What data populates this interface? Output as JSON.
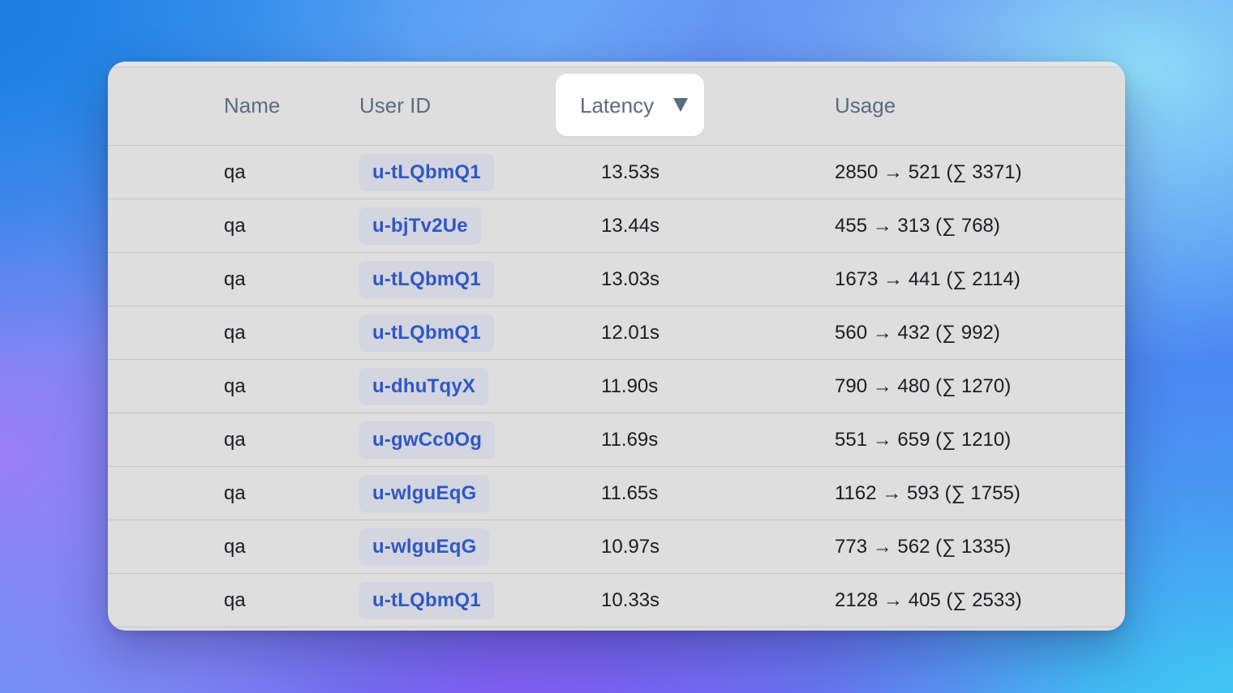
{
  "columns": {
    "name": "Name",
    "user_id": "User ID",
    "latency": "Latency",
    "usage": "Usage"
  },
  "sort": {
    "column": "Latency",
    "direction": "descending"
  },
  "colors": {
    "link": "#2f58c3",
    "chip_bg": "#d3d5e0",
    "header_text": "#5c6b82"
  },
  "rows": [
    {
      "name": "qa",
      "user_id": "u-tLQbmQ1",
      "latency": "13.53s",
      "usage": "2850 → 521 (∑ 3371)"
    },
    {
      "name": "qa",
      "user_id": "u-bjTv2Ue",
      "latency": "13.44s",
      "usage": "455 → 313 (∑ 768)"
    },
    {
      "name": "qa",
      "user_id": "u-tLQbmQ1",
      "latency": "13.03s",
      "usage": "1673 → 441 (∑ 2114)"
    },
    {
      "name": "qa",
      "user_id": "u-tLQbmQ1",
      "latency": "12.01s",
      "usage": "560 → 432 (∑ 992)"
    },
    {
      "name": "qa",
      "user_id": "u-dhuTqyX",
      "latency": "11.90s",
      "usage": "790 → 480 (∑ 1270)"
    },
    {
      "name": "qa",
      "user_id": "u-gwCc0Og",
      "latency": "11.69s",
      "usage": "551 → 659 (∑ 1210)"
    },
    {
      "name": "qa",
      "user_id": "u-wlguEqG",
      "latency": "11.65s",
      "usage": "1162 → 593 (∑ 1755)"
    },
    {
      "name": "qa",
      "user_id": "u-wlguEqG",
      "latency": "10.97s",
      "usage": "773 → 562 (∑ 1335)"
    },
    {
      "name": "qa",
      "user_id": "u-tLQbmQ1",
      "latency": "10.33s",
      "usage": "2128 → 405 (∑ 2533)"
    }
  ]
}
